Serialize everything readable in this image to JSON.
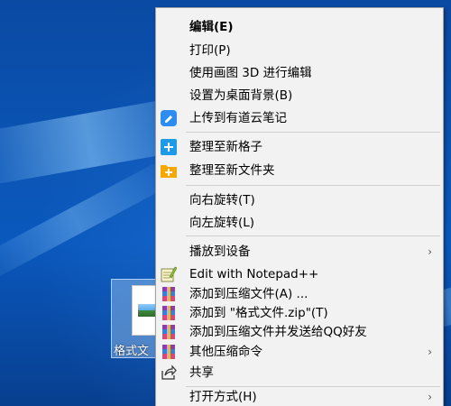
{
  "desktop": {
    "file_label": "格式文"
  },
  "menu": {
    "items": [
      {
        "label": "编辑(E)",
        "bold": true
      },
      {
        "label": "打印(P)"
      },
      {
        "label": "使用画图 3D 进行编辑"
      },
      {
        "label": "设置为桌面背景(B)"
      },
      {
        "label": "上传到有道云笔记",
        "icon": "youdao-note-icon"
      },
      {
        "label": "整理至新格子",
        "icon": "fences-grid-icon"
      },
      {
        "label": "整理至新文件夹",
        "icon": "new-folder-icon"
      },
      {
        "label": "向右旋转(T)"
      },
      {
        "label": "向左旋转(L)"
      },
      {
        "label": "播放到设备",
        "submenu": true
      },
      {
        "label": "Edit with Notepad++",
        "icon": "notepad-plus-plus-icon"
      },
      {
        "label": "添加到压缩文件(A) ...",
        "icon": "winrar-icon"
      },
      {
        "label": "添加到 \"格式文件.zip\"(T)",
        "icon": "winrar-icon"
      },
      {
        "label": "添加到压缩文件并发送给QQ好友",
        "icon": "winrar-icon"
      },
      {
        "label": "其他压缩命令",
        "icon": "winrar-icon",
        "submenu": true
      },
      {
        "label": "共享",
        "icon": "share-icon"
      },
      {
        "label": "打开方式(H)",
        "submenu": true
      }
    ]
  },
  "colors": {
    "menu_background": "#f2f2f2",
    "desktop_blue": "#0b56b7",
    "youdao_blue": "#2d8cf0",
    "fences_blue": "#1e9be8",
    "folder_orange": "#f5a800"
  }
}
